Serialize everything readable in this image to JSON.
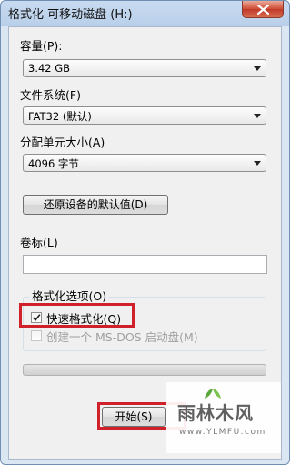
{
  "window": {
    "title": "格式化 可移动磁盘 (H:)"
  },
  "capacity": {
    "label": "容量(P):",
    "value": "3.42 GB"
  },
  "filesystem": {
    "label": "文件系统(F)",
    "value": "FAT32 (默认)"
  },
  "allocation": {
    "label": "分配单元大小(A)",
    "value": "4096 字节"
  },
  "restore_defaults_label": "还原设备的默认值(D)",
  "volume_label": {
    "label": "卷标(L)",
    "value": ""
  },
  "format_options": {
    "title": "格式化选项(O)",
    "quick_format": {
      "label": "快速格式化(Q)",
      "checked": true
    },
    "msdos_disk": {
      "label": "创建一个 MS-DOS 启动盘(M)",
      "checked": false,
      "enabled": false
    }
  },
  "progress": {
    "value": 0
  },
  "start_label": "开始(S)",
  "watermark": {
    "name": "雨林木风",
    "url": "www.YLMFU.com"
  },
  "colors": {
    "highlight": "#d0202a",
    "close_button": "#c0392b"
  }
}
